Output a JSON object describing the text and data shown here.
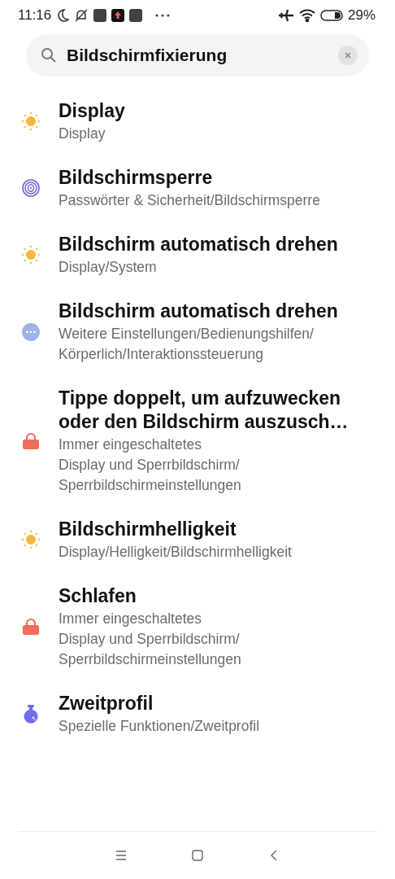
{
  "status_bar": {
    "time": "11:16",
    "battery": "29%"
  },
  "search": {
    "value": "Bildschirmfixierung"
  },
  "results": [
    {
      "kind": "sun",
      "title": "Display",
      "path": [
        "Display"
      ]
    },
    {
      "kind": "fingerprint",
      "title": "Bildschirmsperre",
      "path": [
        "Passwörter & Sicherheit/Bildschirmsperre"
      ]
    },
    {
      "kind": "sun",
      "title": "Bildschirm automatisch drehen",
      "path": [
        "Display/System"
      ]
    },
    {
      "kind": "more",
      "title": "Bildschirm automatisch drehen",
      "path": [
        "Weitere Einstellungen/Bedienungshilfen/",
        "Körperlich/Interaktionssteuerung"
      ]
    },
    {
      "kind": "lock",
      "title": "Tippe doppelt, um aufzuwecken oder den Bildschirm auszusch…",
      "path": [
        "Immer eingeschaltetes",
        "Display und Sperrbildschirm/",
        "Sperrbildschirmeinstellungen"
      ]
    },
    {
      "kind": "sun",
      "title": "Bildschirmhelligkeit",
      "path": [
        "Display/Helligkeit/Bildschirmhelligkeit"
      ]
    },
    {
      "kind": "lock",
      "title": "Schlafen",
      "path": [
        "Immer eingeschaltetes",
        "Display und Sperrbildschirm/",
        "Sperrbildschirmeinstellungen"
      ]
    },
    {
      "kind": "flask",
      "title": "Zweitprofil",
      "path": [
        "Spezielle Funktionen/Zweitprofil"
      ]
    }
  ]
}
